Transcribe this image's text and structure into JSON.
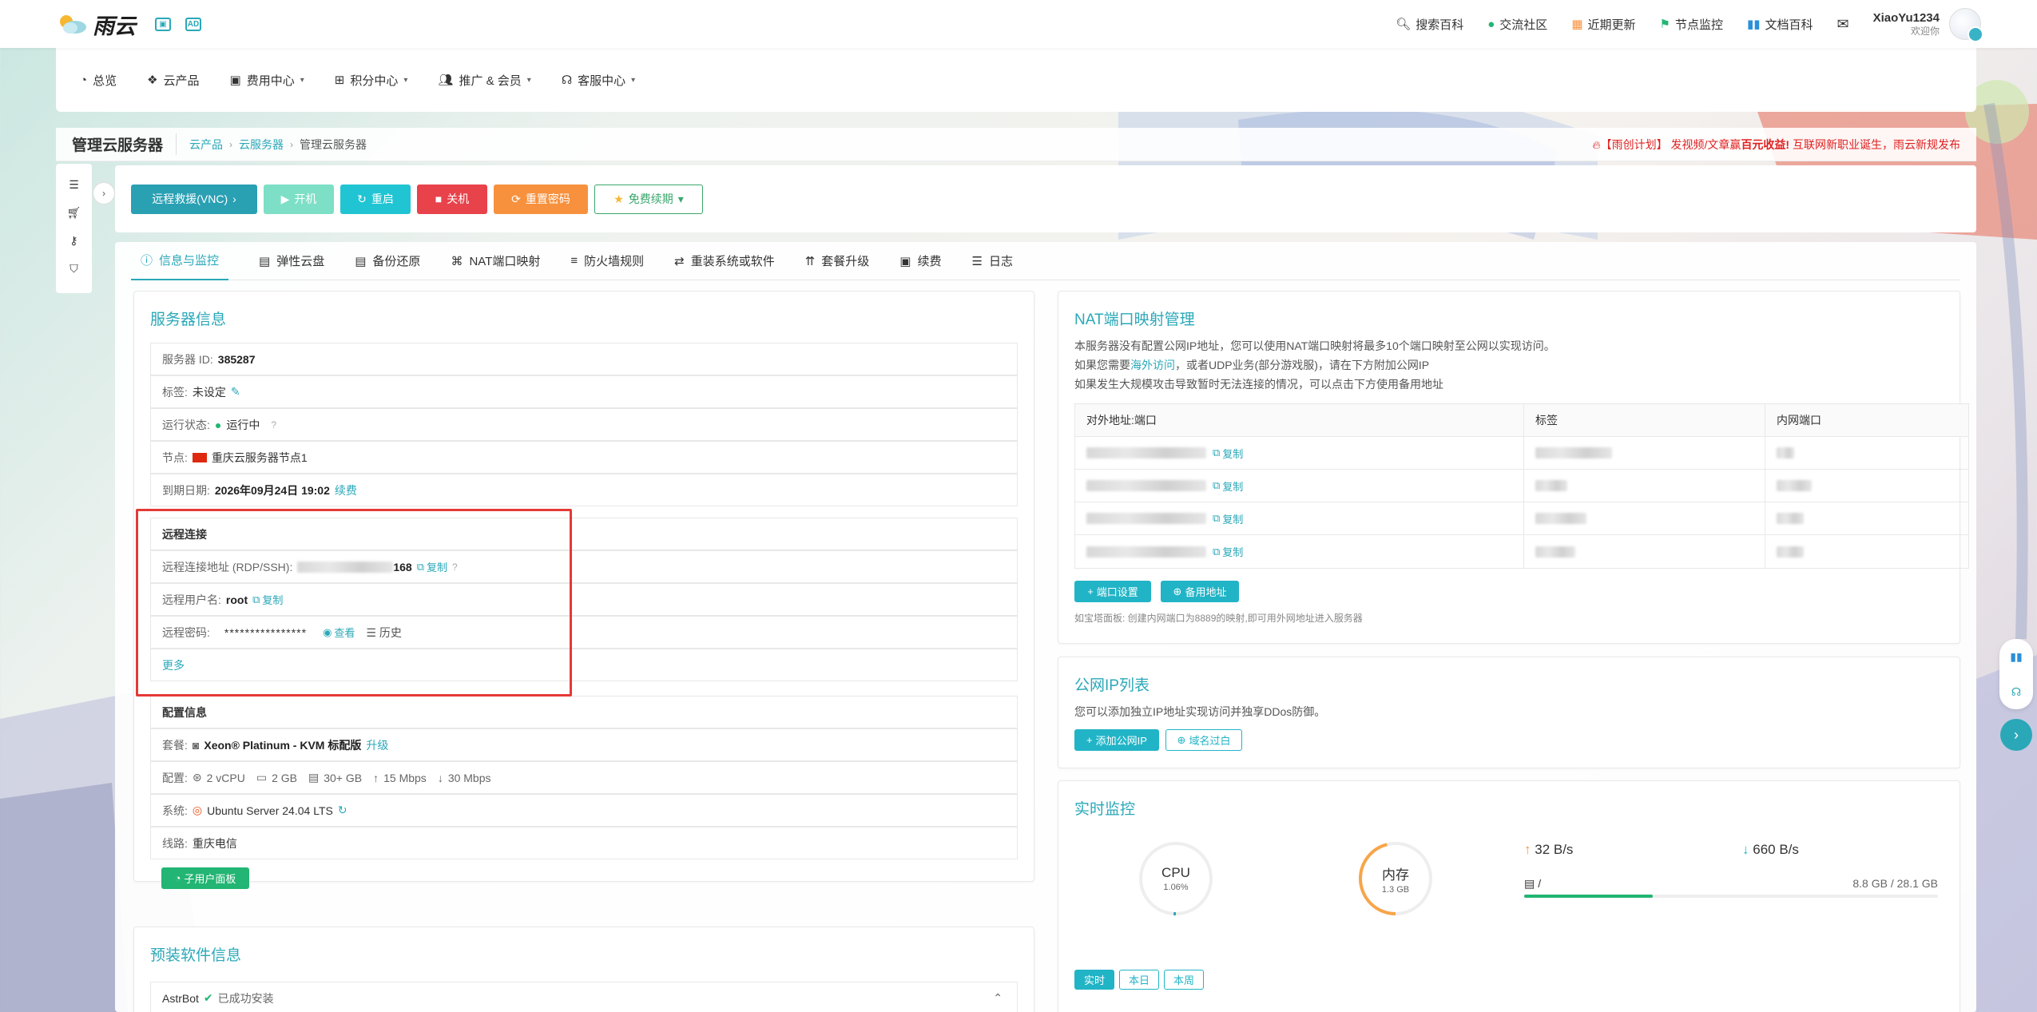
{
  "brand": {
    "name": "雨云",
    "badge": "AD"
  },
  "topnav": {
    "items": [
      "搜索百科",
      "交流社区",
      "近期更新",
      "节点监控",
      "文档百科"
    ],
    "user_name": "XiaoYu1234",
    "user_sub": "欢迎你"
  },
  "mainnav": [
    "总览",
    "云产品",
    "费用中心",
    "积分中心",
    "推广 & 会员",
    "客服中心"
  ],
  "breadcrumb": {
    "title": "管理云服务器",
    "items": [
      "云产品",
      "云服务器",
      "管理云服务器"
    ],
    "promo_prefix": "【雨创计划】",
    "promo_mid": "发视频/文章赢",
    "promo_bold": "百元收益!",
    "promo_suffix": "互联网新职业诞生，雨云新规发布"
  },
  "actions": {
    "vnc": "远程救援(VNC)",
    "start": "开机",
    "reboot": "重启",
    "shutdown": "关机",
    "reset_pwd": "重置密码",
    "renew": "免费续期"
  },
  "tabs": [
    "信息与监控",
    "弹性云盘",
    "备份还原",
    "NAT端口映射",
    "防火墙规则",
    "重装系统或软件",
    "套餐升级",
    "续费",
    "日志"
  ],
  "server_info": {
    "title": "服务器信息",
    "id_label": "服务器 ID:",
    "id_value": "385287",
    "tag_label": "标签:",
    "tag_value": "未设定",
    "status_label": "运行状态:",
    "status_value": "运行中",
    "node_label": "节点:",
    "node_value": "重庆云服务器节点1",
    "expire_label": "到期日期:",
    "expire_value": "2026年09月24日 19:02",
    "expire_action": "续费",
    "remote_title": "远程连接",
    "addr_label": "远程连接地址 (RDP/SSH):",
    "addr_suffix": "168",
    "user_label": "远程用户名:",
    "user_value": "root",
    "pwd_label": "远程密码:",
    "pwd_value": "****************",
    "copy": "复制",
    "view": "查看",
    "history": "历史",
    "more": "更多",
    "config_title": "配置信息",
    "plan_label": "套餐:",
    "plan_value": "Xeon® Platinum - KVM 标配版",
    "plan_action": "升级",
    "spec_label": "配置:",
    "cpu": "2 vCPU",
    "ram": "2 GB",
    "disk": "30+ GB",
    "up": "15 Mbps",
    "down": "30 Mbps",
    "os_label": "系统:",
    "os_value": "Ubuntu Server 24.04 LTS",
    "line_label": "线路:",
    "line_value": "重庆电信",
    "panel_button": "子用户面板"
  },
  "preinstall": {
    "title": "预装软件信息",
    "item": "AstrBot",
    "status": "已成功安装"
  },
  "nat": {
    "title": "NAT端口映射管理",
    "desc1": "本服务器没有配置公网IP地址，您可以使用NAT端口映射将最多10个端口映射至公网以实现访问。",
    "desc2_a": "如果您需要",
    "desc2_link": "海外访问",
    "desc2_b": "，或者UDP业务(部分游戏服)，请在下方附加公网IP",
    "desc3": "如果发生大规模攻击导致暂时无法连接的情况，可以点击下方使用备用地址",
    "headers": [
      "对外地址:端口",
      "标签",
      "内网端口"
    ],
    "copy": "复制",
    "btn_settings": "端口设置",
    "btn_backup": "备用地址",
    "hint": "如宝塔面板: 创建内网端口为8889的映射,即可用外网地址进入服务器"
  },
  "public_ip": {
    "title": "公网IP列表",
    "desc": "您可以添加独立IP地址实现访问并独享DDos防御。",
    "btn_add": "添加公网IP",
    "btn_domain": "域名过白"
  },
  "monitor": {
    "title": "实时监控",
    "cpu_label": "CPU",
    "cpu_value": "1.06%",
    "cpu_pct": 1.06,
    "mem_label": "内存",
    "mem_value": "1.3 GB",
    "mem_pct": 46,
    "up_rate": "32 B/s",
    "down_rate": "660 B/s",
    "disk_mount": "/",
    "disk_usage": "8.8 GB / 28.1 GB",
    "disk_pct": 31,
    "ranges": [
      "实时",
      "本日",
      "本周"
    ]
  },
  "colors": {
    "accent": "#2aa8b8",
    "danger": "#e8424b",
    "warn": "#f7913e",
    "success": "#22b573"
  }
}
